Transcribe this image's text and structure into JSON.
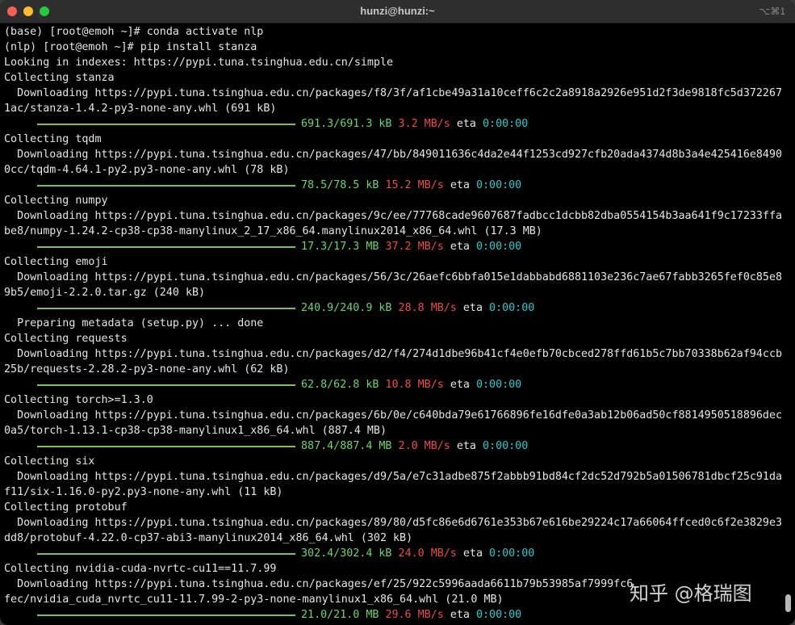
{
  "window": {
    "title": "hunzi@hunzi:~",
    "shortcut": "⌥⌘1"
  },
  "terminal": {
    "lines": [
      {
        "kind": "text",
        "text": "(base) [root@emoh ~]# conda activate nlp"
      },
      {
        "kind": "text",
        "text": "(nlp) [root@emoh ~]# pip install stanza"
      },
      {
        "kind": "text",
        "text": "Looking in indexes: https://pypi.tuna.tsinghua.edu.cn/simple"
      },
      {
        "kind": "text",
        "text": "Collecting stanza"
      },
      {
        "kind": "text",
        "text": "  Downloading https://pypi.tuna.tsinghua.edu.cn/packages/f8/3f/af1cbe49a31a10ceff6c2c2a8918a2926e951d2f3de9818fc5d372267"
      },
      {
        "kind": "text",
        "text": "1ac/stanza-1.4.2-py3-none-any.whl (691 kB)"
      },
      {
        "kind": "progress",
        "size": "691.3/691.3 kB",
        "rate": "3.2 MB/s",
        "eta_label": "eta",
        "eta": "0:00:00"
      },
      {
        "kind": "text",
        "text": "Collecting tqdm"
      },
      {
        "kind": "text",
        "text": "  Downloading https://pypi.tuna.tsinghua.edu.cn/packages/47/bb/849011636c4da2e44f1253cd927cfb20ada4374d8b3a4e425416e8490"
      },
      {
        "kind": "text",
        "text": "0cc/tqdm-4.64.1-py2.py3-none-any.whl (78 kB)"
      },
      {
        "kind": "progress",
        "size": "78.5/78.5 kB",
        "rate": "15.2 MB/s",
        "eta_label": "eta",
        "eta": "0:00:00"
      },
      {
        "kind": "text",
        "text": "Collecting numpy"
      },
      {
        "kind": "text",
        "text": "  Downloading https://pypi.tuna.tsinghua.edu.cn/packages/9c/ee/77768cade9607687fadbcc1dcbb82dba0554154b3aa641f9c17233ffa"
      },
      {
        "kind": "text",
        "text": "be8/numpy-1.24.2-cp38-cp38-manylinux_2_17_x86_64.manylinux2014_x86_64.whl (17.3 MB)"
      },
      {
        "kind": "progress",
        "size": "17.3/17.3 MB",
        "rate": "37.2 MB/s",
        "eta_label": "eta",
        "eta": "0:00:00"
      },
      {
        "kind": "text",
        "text": "Collecting emoji"
      },
      {
        "kind": "text",
        "text": "  Downloading https://pypi.tuna.tsinghua.edu.cn/packages/56/3c/26aefc6bbfa015e1dabbabd6881103e236c7ae67fabb3265fef0c85e8"
      },
      {
        "kind": "text",
        "text": "9b5/emoji-2.2.0.tar.gz (240 kB)"
      },
      {
        "kind": "progress",
        "size": "240.9/240.9 kB",
        "rate": "28.8 MB/s",
        "eta_label": "eta",
        "eta": "0:00:00"
      },
      {
        "kind": "text",
        "text": "  Preparing metadata (setup.py) ... done"
      },
      {
        "kind": "text",
        "text": "Collecting requests"
      },
      {
        "kind": "text",
        "text": "  Downloading https://pypi.tuna.tsinghua.edu.cn/packages/d2/f4/274d1dbe96b41cf4e0efb70cbced278ffd61b5c7bb70338b62af94ccb"
      },
      {
        "kind": "text",
        "text": "25b/requests-2.28.2-py3-none-any.whl (62 kB)"
      },
      {
        "kind": "progress",
        "size": "62.8/62.8 kB",
        "rate": "10.8 MB/s",
        "eta_label": "eta",
        "eta": "0:00:00"
      },
      {
        "kind": "text",
        "text": "Collecting torch>=1.3.0"
      },
      {
        "kind": "text",
        "text": "  Downloading https://pypi.tuna.tsinghua.edu.cn/packages/6b/0e/c640bda79e61766896fe16dfe0a3ab12b06ad50cf8814950518896dec"
      },
      {
        "kind": "text",
        "text": "0a5/torch-1.13.1-cp38-cp38-manylinux1_x86_64.whl (887.4 MB)"
      },
      {
        "kind": "progress",
        "size": "887.4/887.4 MB",
        "rate": "2.0 MB/s",
        "eta_label": "eta",
        "eta": "0:00:00"
      },
      {
        "kind": "text",
        "text": "Collecting six"
      },
      {
        "kind": "text",
        "text": "  Downloading https://pypi.tuna.tsinghua.edu.cn/packages/d9/5a/e7c31adbe875f2abbb91bd84cf2dc52d792b5a01506781dbcf25c91da"
      },
      {
        "kind": "text",
        "text": "f11/six-1.16.0-py2.py3-none-any.whl (11 kB)"
      },
      {
        "kind": "text",
        "text": "Collecting protobuf"
      },
      {
        "kind": "text",
        "text": "  Downloading https://pypi.tuna.tsinghua.edu.cn/packages/89/80/d5fc86e6d6761e353b67e616be29224c17a66064ffced0c6f2e3829e3"
      },
      {
        "kind": "text",
        "text": "dd8/protobuf-4.22.0-cp37-abi3-manylinux2014_x86_64.whl (302 kB)"
      },
      {
        "kind": "progress",
        "size": "302.4/302.4 kB",
        "rate": "24.0 MB/s",
        "eta_label": "eta",
        "eta": "0:00:00"
      },
      {
        "kind": "text",
        "text": "Collecting nvidia-cuda-nvrtc-cu11==11.7.99"
      },
      {
        "kind": "text",
        "text": "  Downloading https://pypi.tuna.tsinghua.edu.cn/packages/ef/25/922c5996aada6611b79b53985af7999fc6"
      },
      {
        "kind": "text",
        "text": "fec/nvidia_cuda_nvrtc_cu11-11.7.99-2-py3-none-manylinux1_x86_64.whl (21.0 MB)"
      },
      {
        "kind": "progress",
        "size": "21.0/21.0 MB",
        "rate": "29.6 MB/s",
        "eta_label": "eta",
        "eta": "0:00:00"
      }
    ]
  },
  "watermark": {
    "text": "知乎 @格瑞图"
  },
  "colors": {
    "background": "#000000",
    "text": "#e6e6e6",
    "progress_bar": "#7fbf5f",
    "size": "#6fd36f",
    "rate": "#e5524a",
    "eta_value": "#31c6cf"
  }
}
